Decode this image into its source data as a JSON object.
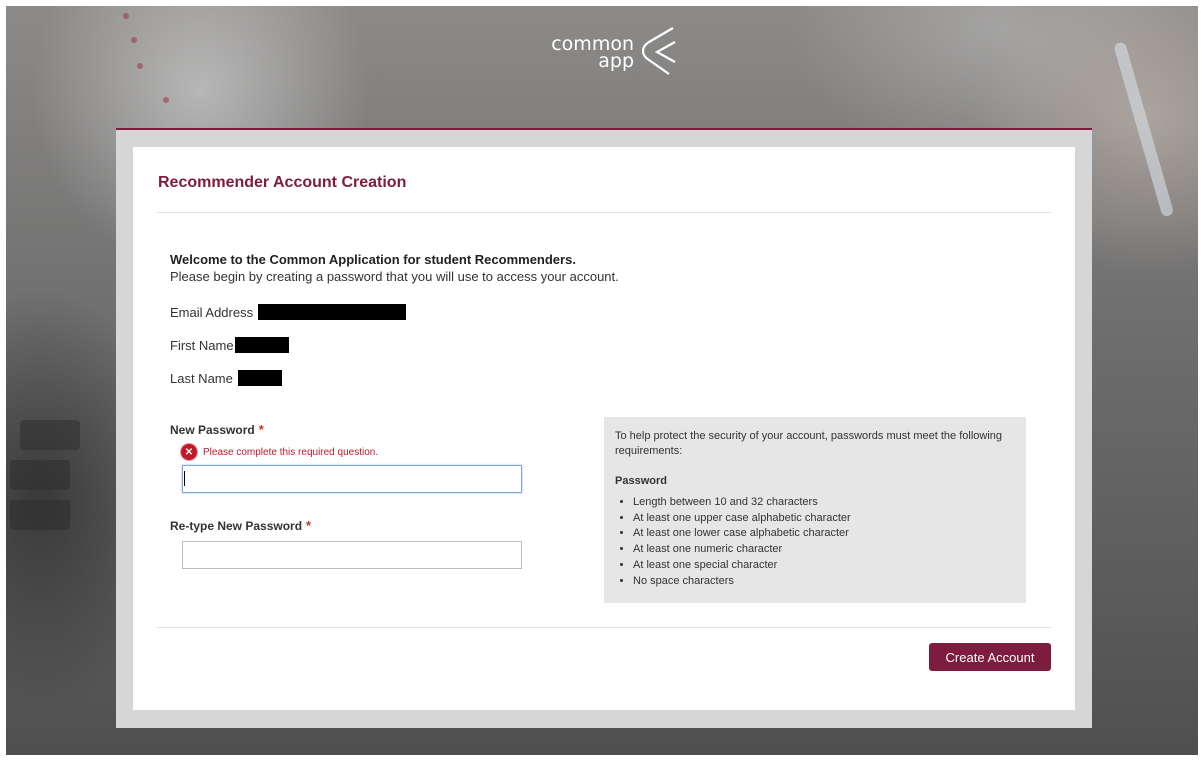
{
  "brand": {
    "logo_line1": "common",
    "logo_line2": "app"
  },
  "page": {
    "title": "Recommender Account Creation",
    "welcome": "Welcome to the Common Application for student Recommenders.",
    "intro": "Please begin by creating a password that you will use to access your account."
  },
  "account": {
    "email_label": "Email Address",
    "first_name_label": "First Name",
    "last_name_label": "Last Name"
  },
  "form": {
    "new_password_label": "New Password",
    "retype_password_label": "Re-type New Password",
    "required_marker": "*",
    "error_message": "Please complete this required question.",
    "new_password_value": "",
    "retype_password_value": ""
  },
  "requirements": {
    "intro": "To help protect the security of your account, passwords must meet the following requirements:",
    "heading": "Password",
    "items": [
      "Length between 10 and 32 characters",
      "At least one upper case alphabetic character",
      "At least one lower case alphabetic character",
      "At least one numeric character",
      "At least one special character",
      "No space characters"
    ]
  },
  "actions": {
    "create_account_label": "Create Account"
  },
  "colors": {
    "accent": "#7d1c3e",
    "error": "#c0192c",
    "panel_bg": "#e6e6e6"
  }
}
